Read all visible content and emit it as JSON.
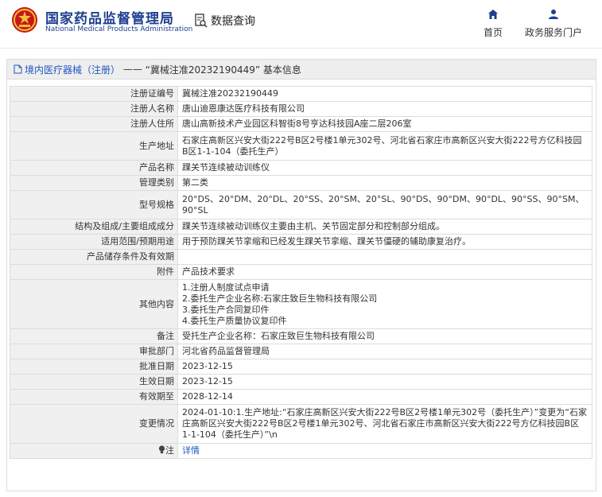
{
  "header": {
    "brand_cn": "国家药品监督管理局",
    "brand_en": "National Medical Products Administration",
    "search_label": "数据查询",
    "nav_home": "首页",
    "nav_service": "政务服务门户"
  },
  "titlebar": {
    "category": "境内医疗器械（注册）",
    "separator": "——",
    "record": "“冀械注准20232190449”",
    "suffix": "基本信息"
  },
  "rows": [
    {
      "label": "注册证编号",
      "value": "冀械注准20232190449"
    },
    {
      "label": "注册人名称",
      "value": "唐山迪恩康达医疗科技有限公司"
    },
    {
      "label": "注册人住所",
      "value": "唐山高新技术产业园区科智街8号亨达科技园A座二层206室"
    },
    {
      "label": "生产地址",
      "value": "石家庄高新区兴安大街222号B区2号楼1单元302号、河北省石家庄市高新区兴安大街222号方亿科技园B区1-1-104（委托生产）"
    },
    {
      "label": "产品名称",
      "value": "踝关节连续被动训练仪"
    },
    {
      "label": "管理类别",
      "value": "第二类"
    },
    {
      "label": "型号规格",
      "value": "20°DS、20°DM、20°DL、20°SS、20°SM、20°SL、90°DS、90°DM、90°DL、90°SS、90°SM、90°SL"
    },
    {
      "label": "结构及组成/主要组成成分",
      "value": "踝关节连续被动训练仪主要由主机、关节固定部分和控制部分组成。"
    },
    {
      "label": "适用范围/预期用途",
      "value": "用于预防踝关节挛缩和已经发生踝关节挛缩、踝关节僵硬的辅助康复治疗。"
    },
    {
      "label": "产品储存条件及有效期",
      "value": ""
    },
    {
      "label": "附件",
      "value": "产品技术要求"
    },
    {
      "label": "其他内容",
      "lines": [
        "1.注册人制度试点申请",
        "2.委托生产企业名称:石家庄致巨生物科技有限公司",
        "3.委托生产合同复印件",
        "4.委托生产质量协议复印件"
      ]
    },
    {
      "label": "备注",
      "value": "受托生产企业名称：石家庄致巨生物科技有限公司"
    },
    {
      "label": "审批部门",
      "value": "河北省药品监督管理局"
    },
    {
      "label": "批准日期",
      "value": "2023-12-15"
    },
    {
      "label": "生效日期",
      "value": "2023-12-15"
    },
    {
      "label": "有效期至",
      "value": "2028-12-14"
    },
    {
      "label": "变更情况",
      "value": "2024-01-10:1.生产地址:“石家庄高新区兴安大街222号B区2号楼1单元302号（委托生产）”变更为“石家庄高新区兴安大街222号B区2号楼1单元302号、河北省石家庄市高新区兴安大街222号方亿科技园B区1-1-104（委托生产）”\\n"
    },
    {
      "label": "注",
      "value": "详情",
      "icon": "lightbulb-icon"
    }
  ],
  "colors": {
    "brand": "#1f3f8f",
    "link": "#1f56c2",
    "label_bg": "#f0f0f0",
    "emblem_red": "#c8161d",
    "emblem_gold": "#f2c12e"
  }
}
